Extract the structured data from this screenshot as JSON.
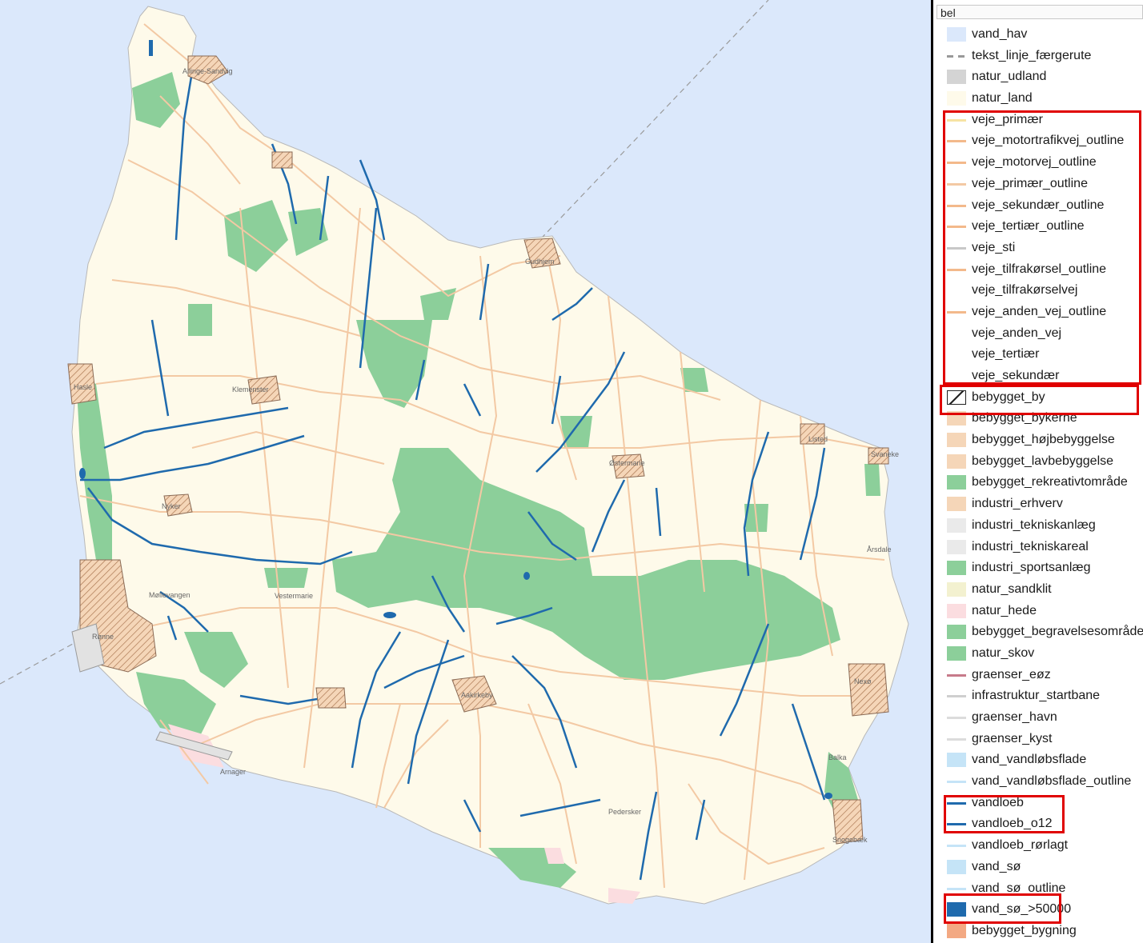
{
  "map": {
    "place_labels": [
      {
        "name": "Allinge-Sandvig"
      },
      {
        "name": "Gudhjem"
      },
      {
        "name": "Hasle"
      },
      {
        "name": "Klemenster"
      },
      {
        "name": "Nyker"
      },
      {
        "name": "Østermarie"
      },
      {
        "name": "Listed"
      },
      {
        "name": "Svaneke"
      },
      {
        "name": "Årsdale"
      },
      {
        "name": "Møllevangen"
      },
      {
        "name": "Vestermarie"
      },
      {
        "name": "Rønne"
      },
      {
        "name": "Aakirkeby"
      },
      {
        "name": "Nexø"
      },
      {
        "name": "Balka"
      },
      {
        "name": "Arnager"
      },
      {
        "name": "Pedersker"
      },
      {
        "name": "Snogebæk"
      }
    ]
  },
  "legend": {
    "header": "bel",
    "items": [
      {
        "label": "vand_hav",
        "type": "fill",
        "color": "#dbe8fb"
      },
      {
        "label": "tekst_linje_færgerute",
        "type": "dash",
        "color": "#999999"
      },
      {
        "label": "natur_udland",
        "type": "fill",
        "color": "#d4d4d4"
      },
      {
        "label": "natur_land",
        "type": "fill",
        "color": "#fefaea"
      },
      {
        "label": "veje_primær",
        "type": "line",
        "color": "#f7e3a3"
      },
      {
        "label": "veje_motortrafikvej_outline",
        "type": "line",
        "color": "#f3b98b"
      },
      {
        "label": "veje_motorvej_outline",
        "type": "line",
        "color": "#f3b98b"
      },
      {
        "label": "veje_primær_outline",
        "type": "line",
        "color": "#f3c9a4"
      },
      {
        "label": "veje_sekundær_outline",
        "type": "line",
        "color": "#f3b98b"
      },
      {
        "label": "veje_tertiær_outline",
        "type": "line",
        "color": "#f3b98b"
      },
      {
        "label": "veje_sti",
        "type": "line",
        "color": "#c8c8c8"
      },
      {
        "label": "veje_tilfrakørsel_outline",
        "type": "line",
        "color": "#f3b98b"
      },
      {
        "label": "veje_tilfrakørselvej",
        "type": "none",
        "color": "#ffffff"
      },
      {
        "label": "veje_anden_vej_outline",
        "type": "line",
        "color": "#f3b98b"
      },
      {
        "label": "veje_anden_vej",
        "type": "none",
        "color": "#ffffff"
      },
      {
        "label": "veje_tertiær",
        "type": "none",
        "color": "#ffffff"
      },
      {
        "label": "veje_sekundær",
        "type": "none",
        "color": "#ffffff"
      },
      {
        "label": "bebygget_by",
        "type": "hatch",
        "color": "#222222"
      },
      {
        "label": "bebygget_bykerne",
        "type": "fill",
        "color": "#f5d6b8"
      },
      {
        "label": "bebygget_højbebyggelse",
        "type": "fill",
        "color": "#f5d6b8"
      },
      {
        "label": "bebygget_lavbebyggelse",
        "type": "fill",
        "color": "#f5d6b8"
      },
      {
        "label": "bebygget_rekreativtområde",
        "type": "fill",
        "color": "#8ccf9a"
      },
      {
        "label": "industri_erhverv",
        "type": "fill",
        "color": "#f5d6b8"
      },
      {
        "label": "industri_tekniskanlæg",
        "type": "fill",
        "color": "#eaeaea"
      },
      {
        "label": "industri_tekniskareal",
        "type": "fill",
        "color": "#eaeaea"
      },
      {
        "label": "industri_sportsanlæg",
        "type": "fill",
        "color": "#8ccf9a"
      },
      {
        "label": "natur_sandklit",
        "type": "fill",
        "color": "#f3f1d0"
      },
      {
        "label": "natur_hede",
        "type": "fill",
        "color": "#fbdde0"
      },
      {
        "label": "bebygget_begravelsesområde",
        "type": "fill",
        "color": "#8ccf9a"
      },
      {
        "label": "natur_skov",
        "type": "fill",
        "color": "#8ccf9a"
      },
      {
        "label": "graenser_eøz",
        "type": "line",
        "color": "#c77a8a"
      },
      {
        "label": "infrastruktur_startbane",
        "type": "line",
        "color": "#cfcfcf"
      },
      {
        "label": "graenser_havn",
        "type": "line",
        "color": "#dcdcdc"
      },
      {
        "label": "graenser_kyst",
        "type": "line",
        "color": "#dcdcdc"
      },
      {
        "label": "vand_vandløbsflade",
        "type": "fill",
        "color": "#c5e4f7"
      },
      {
        "label": "vand_vandløbsflade_outline",
        "type": "line",
        "color": "#c5e4f7"
      },
      {
        "label": "vandloeb",
        "type": "line",
        "color": "#1f6aad"
      },
      {
        "label": "vandloeb_o12",
        "type": "line",
        "color": "#1f6aad"
      },
      {
        "label": "vandloeb_rørlagt",
        "type": "line",
        "color": "#c5e4f7"
      },
      {
        "label": "vand_sø",
        "type": "fill",
        "color": "#c5e4f7"
      },
      {
        "label": "vand_sø_outline",
        "type": "line",
        "color": "#c5e4f7"
      },
      {
        "label": "vand_sø_>50000",
        "type": "fill",
        "color": "#1f6aad"
      },
      {
        "label": "bebygget_bygning",
        "type": "fill",
        "color": "#f3a983"
      }
    ]
  }
}
